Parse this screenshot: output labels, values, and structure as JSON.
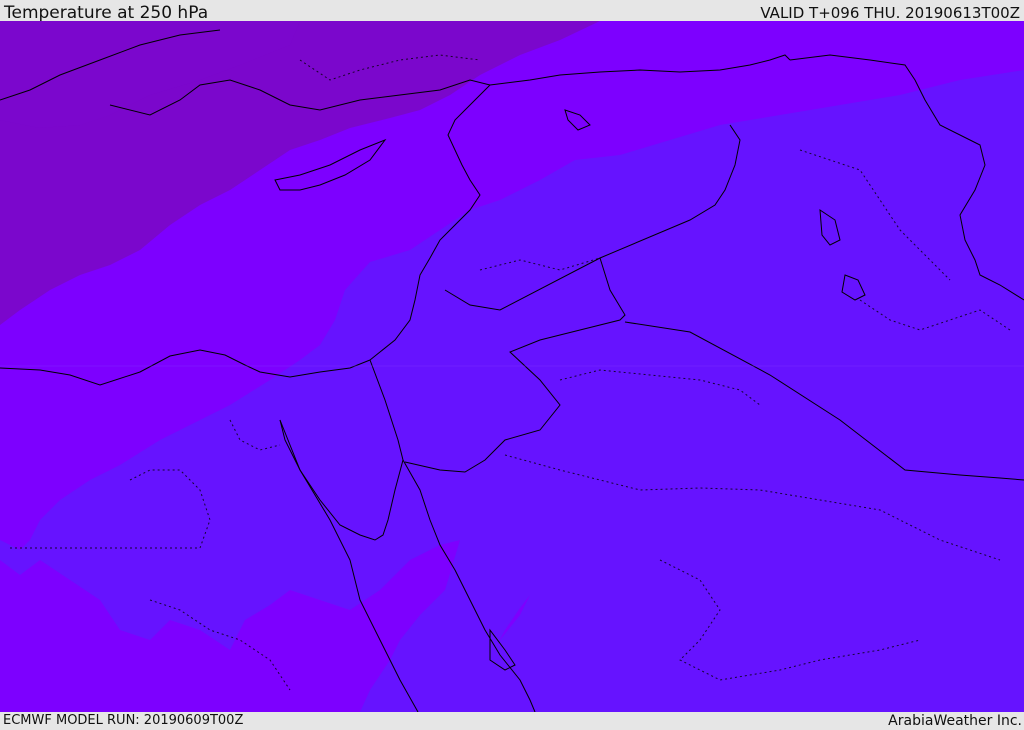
{
  "header": {
    "title": "Temperature at 250 hPa",
    "valid": "VALID T+096 THU. 20190613T00Z"
  },
  "footer": {
    "model_run": "ECMWF MODEL RUN: 20190609T00Z",
    "brand": "ArabiaWeather Inc."
  },
  "colors": {
    "band_dark": "#7B07CC",
    "band_mid": "#7D00FF",
    "band_light": "#6613FF",
    "coastline": "#000000"
  }
}
